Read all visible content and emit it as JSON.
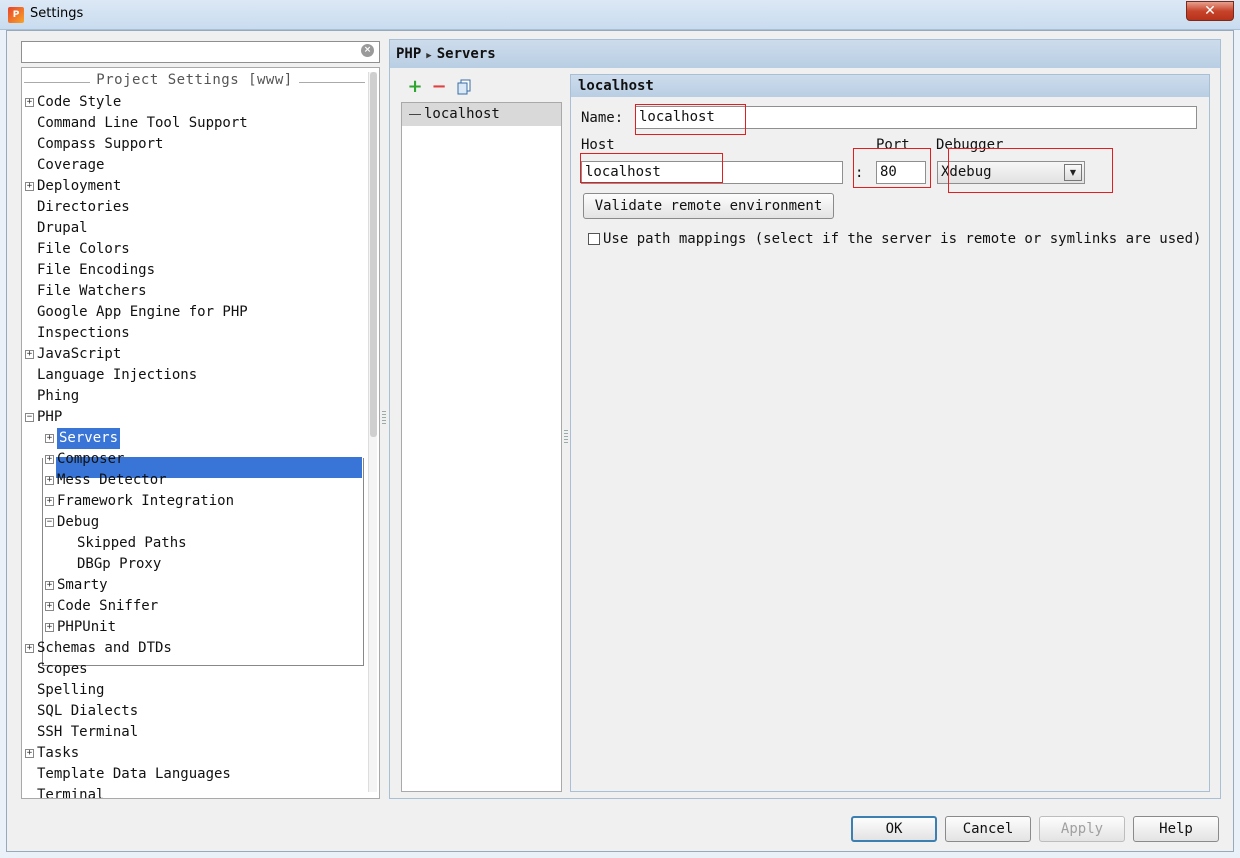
{
  "window": {
    "title": "Settings",
    "close_glyph": "✕"
  },
  "colors": {
    "selection": "#3875d7",
    "header_bar": "#c3d5e8",
    "highlight_box": "#e02020",
    "add_icon": "#2ea52e",
    "remove_icon": "#e04040"
  },
  "sidebar": {
    "search_value": "",
    "section_title": "Project Settings [www]",
    "items": [
      {
        "label": "Code Style",
        "expander": "+",
        "level": 0
      },
      {
        "label": "Command Line Tool Support",
        "expander": "",
        "level": 0
      },
      {
        "label": "Compass Support",
        "expander": "",
        "level": 0
      },
      {
        "label": "Coverage",
        "expander": "",
        "level": 0
      },
      {
        "label": "Deployment",
        "expander": "+",
        "level": 0
      },
      {
        "label": "Directories",
        "expander": "",
        "level": 0
      },
      {
        "label": "Drupal",
        "expander": "",
        "level": 0
      },
      {
        "label": "File Colors",
        "expander": "",
        "level": 0
      },
      {
        "label": "File Encodings",
        "expander": "",
        "level": 0
      },
      {
        "label": "File Watchers",
        "expander": "",
        "level": 0
      },
      {
        "label": "Google App Engine for PHP",
        "expander": "",
        "level": 0
      },
      {
        "label": "Inspections",
        "expander": "",
        "level": 0
      },
      {
        "label": "JavaScript",
        "expander": "+",
        "level": 0
      },
      {
        "label": "Language Injections",
        "expander": "",
        "level": 0
      },
      {
        "label": "Phing",
        "expander": "",
        "level": 0
      },
      {
        "label": "PHP",
        "expander": "−",
        "level": 0
      },
      {
        "label": "Servers",
        "expander": "+",
        "level": 1,
        "selected": true
      },
      {
        "label": "Composer",
        "expander": "+",
        "level": 1
      },
      {
        "label": "Mess Detector",
        "expander": "+",
        "level": 1
      },
      {
        "label": "Framework Integration",
        "expander": "+",
        "level": 1
      },
      {
        "label": "Debug",
        "expander": "−",
        "level": 1
      },
      {
        "label": "Skipped Paths",
        "expander": "",
        "level": 2
      },
      {
        "label": "DBGp Proxy",
        "expander": "",
        "level": 2
      },
      {
        "label": "Smarty",
        "expander": "+",
        "level": 1
      },
      {
        "label": "Code Sniffer",
        "expander": "+",
        "level": 1
      },
      {
        "label": "PHPUnit",
        "expander": "+",
        "level": 1
      },
      {
        "label": "Schemas and DTDs",
        "expander": "+",
        "level": 0
      },
      {
        "label": "Scopes",
        "expander": "",
        "level": 0
      },
      {
        "label": "Spelling",
        "expander": "",
        "level": 0
      },
      {
        "label": "SQL Dialects",
        "expander": "",
        "level": 0
      },
      {
        "label": "SSH Terminal",
        "expander": "",
        "level": 0
      },
      {
        "label": "Tasks",
        "expander": "+",
        "level": 0
      },
      {
        "label": "Template Data Languages",
        "expander": "",
        "level": 0
      },
      {
        "label": "Terminal",
        "expander": "",
        "level": 0
      }
    ]
  },
  "breadcrumb": {
    "parent": "PHP",
    "current": "Servers",
    "separator": "▶"
  },
  "toolbar": {
    "add": "+",
    "remove": "−",
    "copy_icon": "copy-icon"
  },
  "servers": {
    "items": [
      "localhost"
    ]
  },
  "detail": {
    "header": "localhost",
    "name_label": "Name:",
    "name_value": "localhost",
    "host_label": "Host",
    "host_value": "localhost",
    "port_label": "Port",
    "port_separator": ":",
    "port_value": "80",
    "debugger_label": "Debugger",
    "debugger_value": "Xdebug",
    "debugger_arrow": "▼",
    "validate_button": "Validate remote environment",
    "path_mappings_label": "Use path mappings (select if the server is remote or symlinks are used)",
    "path_mappings_checked": false
  },
  "footer": {
    "ok": "OK",
    "cancel": "Cancel",
    "apply": "Apply",
    "help": "Help"
  }
}
